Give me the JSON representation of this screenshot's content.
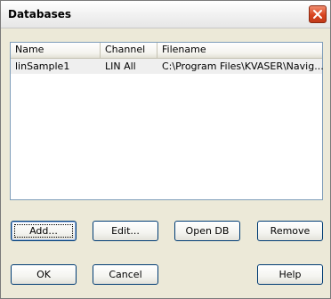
{
  "window": {
    "title": "Databases"
  },
  "list": {
    "columns": [
      "Name",
      "Channel",
      "Filename"
    ],
    "rows": [
      {
        "name": "linSample1",
        "channel": "LIN All",
        "filename": "C:\\Program Files\\KVASER\\Navig..."
      }
    ]
  },
  "buttons": {
    "add": "Add...",
    "edit": "Edit...",
    "open_db": "Open DB",
    "remove": "Remove",
    "ok": "OK",
    "cancel": "Cancel",
    "help": "Help"
  },
  "colors": {
    "dialog_bg": "#ece9d8",
    "button_border": "#003c74",
    "close_red": "#d8431f"
  },
  "icons": {
    "close": "close-icon"
  }
}
